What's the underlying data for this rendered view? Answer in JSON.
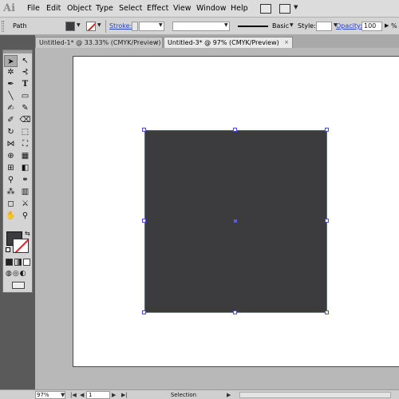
{
  "app": {
    "logo": "Ai"
  },
  "menu": {
    "items": [
      "File",
      "Edit",
      "Object",
      "Type",
      "Select",
      "Effect",
      "View",
      "Window",
      "Help"
    ]
  },
  "control_bar": {
    "selection_label": "Path",
    "stroke_label": "Stroke:",
    "brush_label": "Basic",
    "style_label": "Style:",
    "opacity_label": "Opacity:",
    "opacity_value": "100",
    "opacity_unit": "%",
    "fill_color": "#3c3b3d"
  },
  "tabs": [
    {
      "label": "Untitled-1* @ 33.33% (CMYK/Preview)",
      "close": "×"
    },
    {
      "label": "Untitled-3* @ 97% (CMYK/Preview)",
      "close": "×"
    }
  ],
  "status": {
    "zoom": "97%",
    "page": "1",
    "label": "Selection"
  },
  "canvas": {
    "shape_fill": "#3c3b3d",
    "selection_color": "#5a5adc",
    "artboard_color": "#ffffff"
  },
  "icons": {
    "selection": "selection-tool-icon",
    "direct_selection": "direct-selection-tool-icon"
  }
}
